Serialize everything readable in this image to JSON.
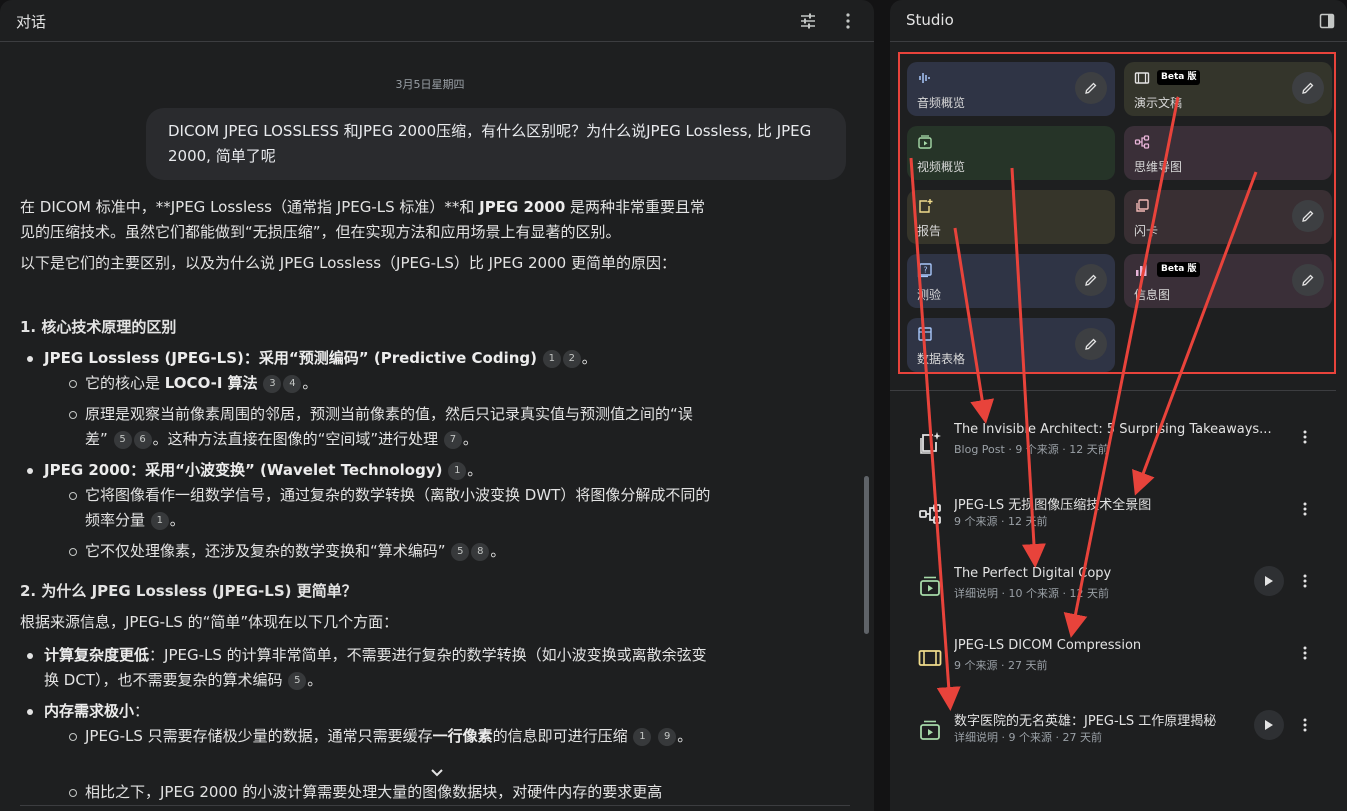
{
  "chat": {
    "title": "对话",
    "date": "3月5日星期四",
    "user_message": "DICOM JPEG LOSSLESS 和JPEG 2000压缩，有什么区别呢？为什么说JPEG Lossless, 比 JPEG 2000, 简单了呢",
    "answer": {
      "intro1_pre": "在 DICOM 标准中，**JPEG Lossless（通常指 JPEG-LS 标准）**和 ",
      "intro1_bold": "JPEG 2000",
      "intro1_post": " 是两种非常重要且常见的压缩技术。虽然它们都能做到“无损压缩”，但在实现方法和应用场景上有显著的区别。",
      "intro2": "以下是它们的主要区别，以及为什么说 JPEG Lossless（JPEG-LS）比 JPEG 2000 更简单的原因：",
      "h1": "1. 核心技术原理的区别",
      "b1_bold": "JPEG Lossless (JPEG-LS)：采用“预测编码” (Predictive Coding)",
      "b1_c1": "1",
      "b1_c2": "2",
      "b1_end": "。",
      "b1s1_pre": "它的核心是 ",
      "b1s1_bold": "LOCO-I 算法",
      "b1s1_c1": "3",
      "b1s1_c2": "4",
      "b1s1_end": "。",
      "b1s2_text": "原理是观察当前像素周围的邻居，预测当前像素的值，然后只记录真实值与预测值之间的“误差”",
      "b1s2_c1": "5",
      "b1s2_c2": "6",
      "b1s2_text2": "。这种方法直接在图像的“空间域”进行处理",
      "b1s2_c3": "7",
      "b1s2_end": "。",
      "b2_bold": "JPEG 2000：采用“小波变换” (Wavelet Technology)",
      "b2_c1": "1",
      "b2_end": "。",
      "b2s1_text": "它将图像看作一组数学信号，通过复杂的数学转换（离散小波变换 DWT）将图像分解成不同的频率分量",
      "b2s1_c1": "1",
      "b2s1_end": "。",
      "b2s2_text": "它不仅处理像素，还涉及复杂的数学变换和“算术编码”",
      "b2s2_c1": "5",
      "b2s2_c2": "8",
      "b2s2_end": "。",
      "h2": "2. 为什么 JPEG Lossless (JPEG-LS) 更简单？",
      "p3": "根据来源信息，JPEG-LS 的“简单”体现在以下几个方面：",
      "b3_bold": "计算复杂度更低",
      "b3_text": "：JPEG-LS 的计算非常简单，不需要进行复杂的数学转换（如小波变换或离散余弦变换 DCT），也不需要复杂的算术编码",
      "b3_c1": "5",
      "b3_end": "。",
      "b4_bold": "内存需求极小",
      "b4_end": "：",
      "b4s1_pre": "JPEG-LS 只需要存储极少量的数据，通常只需要缓存",
      "b4s1_bold": "一行像素",
      "b4s1_post": "的信息即可进行压缩",
      "b4s1_c1": "1",
      "b4s1_c2": "9",
      "b4s1_end": "。",
      "b4s2_text": "相比之下，JPEG 2000 的小波计算需要处理大量的图像数据块，对硬件内存的要求更高"
    }
  },
  "studio": {
    "title": "Studio",
    "beta_label": "Beta 版",
    "tiles": [
      {
        "label": "音频概览",
        "icon": "audio-waves-icon"
      },
      {
        "label": "演示文稿",
        "icon": "slides-icon"
      },
      {
        "label": "视频概览",
        "icon": "video-icon"
      },
      {
        "label": "思维导图",
        "icon": "mind-map-icon"
      },
      {
        "label": "报告",
        "icon": "report-icon"
      },
      {
        "label": "闪卡",
        "icon": "flashcards-icon"
      },
      {
        "label": "测验",
        "icon": "quiz-icon"
      },
      {
        "label": "信息图",
        "icon": "infographic-icon"
      },
      {
        "label": "数据表格",
        "icon": "data-table-icon"
      }
    ],
    "notes": [
      {
        "title": "The Invisible Architect: 5 Surprising Takeaways...",
        "sub": "Blog Post · 9 个来源 · 12 天前",
        "icon": "report-sparkle-icon"
      },
      {
        "title": "JPEG-LS 无损图像压缩技术全景图",
        "sub": "9 个来源 · 12 天前",
        "icon": "mind-map-icon"
      },
      {
        "title": "The Perfect Digital Copy",
        "sub": "详细说明 · 10 个来源 · 12 天前",
        "icon": "video-icon"
      },
      {
        "title": "JPEG-LS DICOM Compression",
        "sub": "9 个来源 · 27 天前",
        "icon": "slides-icon"
      },
      {
        "title": "数字医院的无名英雄：JPEG-LS 工作原理揭秘",
        "sub": "详细说明 · 9 个来源 · 27 天前",
        "icon": "video-icon"
      }
    ]
  },
  "colors": {
    "annotation_red": "#e8433b",
    "tile_audio": "#2f3445",
    "tile_slides": "#34352b",
    "tile_video": "#263428",
    "tile_mindmap": "#3a2f38",
    "tile_report": "#36352a",
    "tile_flashcards": "#392f33",
    "tile_quiz": "#2f3445",
    "tile_infographic": "#3a2f38",
    "tile_table": "#2f3445"
  }
}
